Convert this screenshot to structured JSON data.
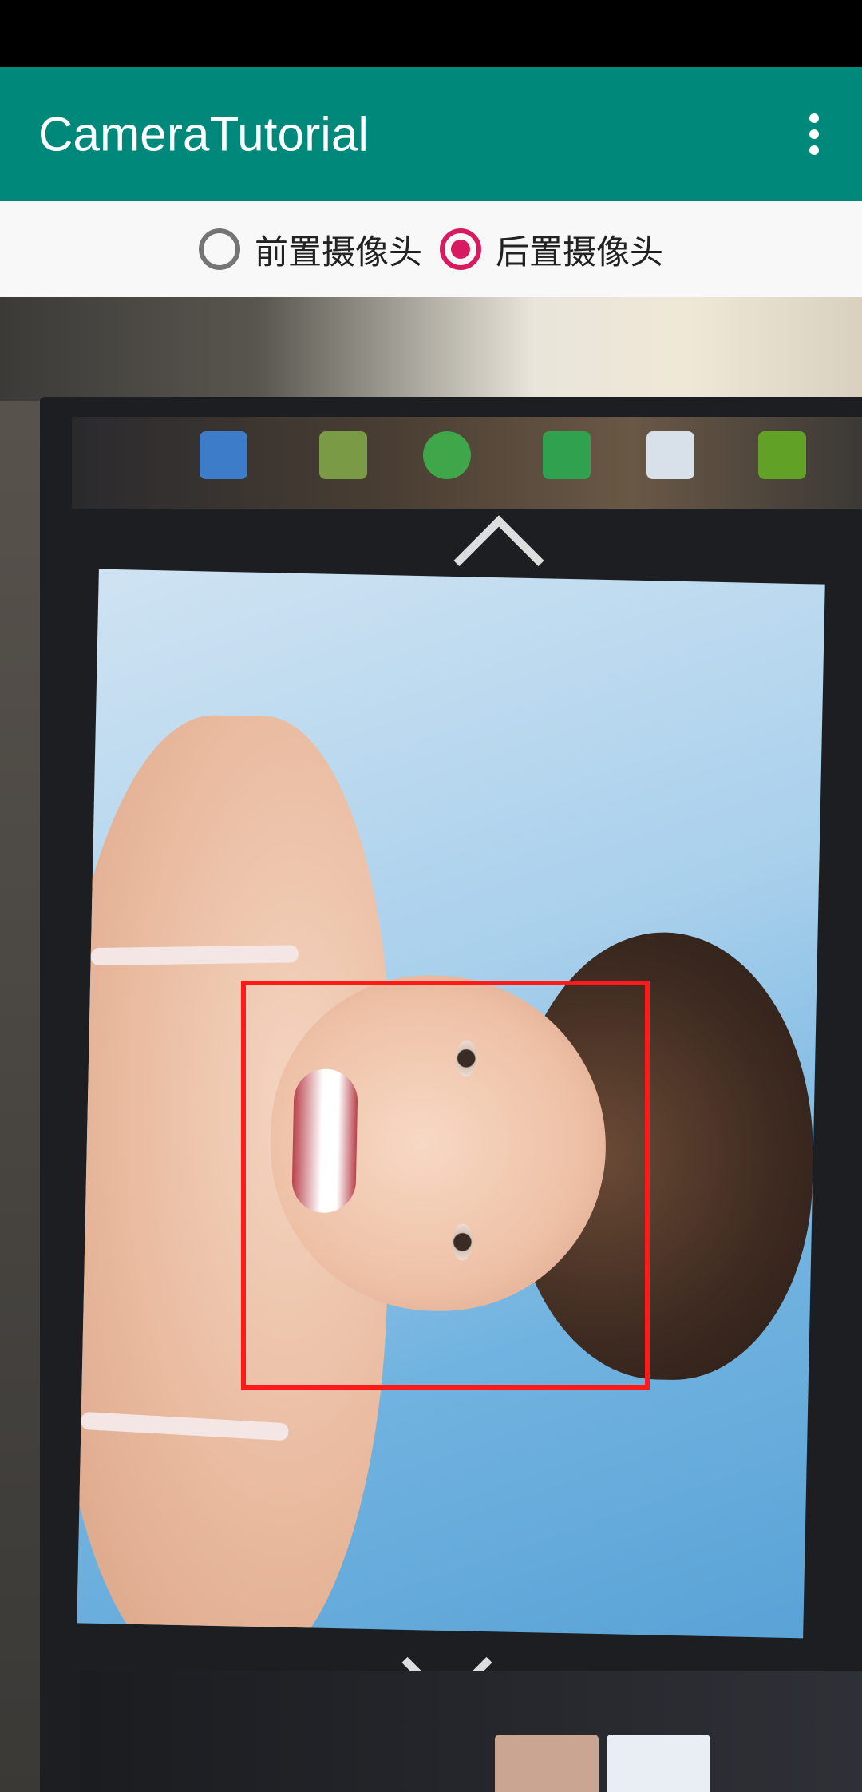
{
  "app_bar": {
    "title": "CameraTutorial",
    "background_color": "#00897b",
    "overflow_icon": "more-vert-icon"
  },
  "camera_selector": {
    "options": [
      {
        "label": "前置摄像头",
        "selected": false
      },
      {
        "label": "后置摄像头",
        "selected": true
      }
    ],
    "accent_color": "#d81b60"
  },
  "preview": {
    "face_box_color": "#ff1a1a"
  }
}
